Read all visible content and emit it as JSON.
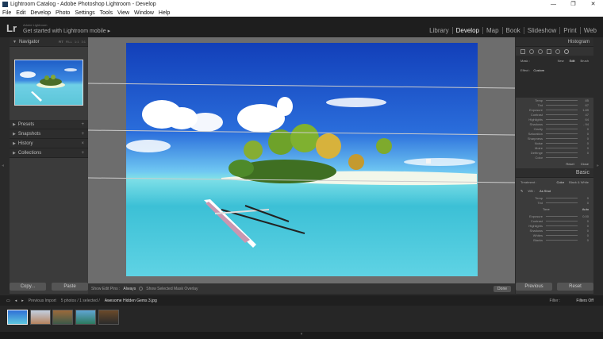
{
  "window": {
    "title": "Lightroom Catalog - Adobe Photoshop Lightroom - Develop",
    "controls": [
      "—",
      "❐",
      "✕"
    ]
  },
  "menu": [
    "File",
    "Edit",
    "Develop",
    "Photo",
    "Settings",
    "Tools",
    "View",
    "Window",
    "Help"
  ],
  "identity": {
    "logo": "Lr",
    "adobe": "Adobe Lightroom",
    "get_started": "Get started with Lightroom mobile ▸"
  },
  "modules": [
    "Library",
    "Develop",
    "Map",
    "Book",
    "Slideshow",
    "Print",
    "Web"
  ],
  "active_module": "Develop",
  "left_panel": {
    "navigator": "Navigator",
    "nav_zoom": [
      "FIT",
      "FILL",
      "1:1",
      "3:1"
    ],
    "sections": [
      "Presets",
      "Snapshots",
      "History",
      "Collections"
    ],
    "copy_btn": "Copy...",
    "paste_btn": "Paste"
  },
  "toolbar": {
    "show_edit_pins": "Show Edit Pins :",
    "edit_pins_value": "Always",
    "show_overlay": "Show Selected Mask Overlay",
    "done": "Done"
  },
  "right_panel": {
    "histogram": "Histogram",
    "mask_labels": [
      "Mask :",
      "New",
      "Edit",
      "Brush"
    ],
    "effect_label": "Effect :",
    "effect_value": "Custom",
    "local_sliders": [
      {
        "label": "Temp",
        "value": "85"
      },
      {
        "label": "Tint",
        "value": "67"
      },
      {
        "label": "Exposure",
        "value": "1.89"
      },
      {
        "label": "Contrast",
        "value": "47"
      },
      {
        "label": "Highlights",
        "value": "64"
      },
      {
        "label": "Shadows",
        "value": "- 94"
      },
      {
        "label": "Clarity",
        "value": "0"
      },
      {
        "label": "Saturation",
        "value": "0"
      },
      {
        "label": "Sharpness",
        "value": "0"
      },
      {
        "label": "Noise",
        "value": "0"
      },
      {
        "label": "Moire",
        "value": "0"
      },
      {
        "label": "Defringe",
        "value": "0"
      },
      {
        "label": "Color",
        "value": ""
      }
    ],
    "reset_close": [
      "Reset",
      "Close"
    ],
    "basic": "Basic",
    "treatment": [
      "Treatment :",
      "Color",
      "Black & White"
    ],
    "wb_label": "WB :",
    "wb_value": "As Shot",
    "basic_sliders": [
      {
        "label": "Temp",
        "value": "0"
      },
      {
        "label": "Tint",
        "value": "0"
      }
    ],
    "tone": "Tone",
    "auto": "Auto",
    "tone_sliders": [
      {
        "label": "Exposure",
        "value": "0.00"
      },
      {
        "label": "Contrast",
        "value": "0"
      },
      {
        "label": "Highlights",
        "value": "0"
      },
      {
        "label": "Shadows",
        "value": "0"
      },
      {
        "label": "Whites",
        "value": "0"
      },
      {
        "label": "Blacks",
        "value": "0"
      }
    ],
    "previous_btn": "Previous",
    "reset_btn": "Reset"
  },
  "filmbar": {
    "source": "Previous Import",
    "count": "5 photos / 1 selected /",
    "file": "Awesome Hidden Gems 3.jpg",
    "filter_label": "Filter :",
    "filter_value": "Filters Off"
  }
}
